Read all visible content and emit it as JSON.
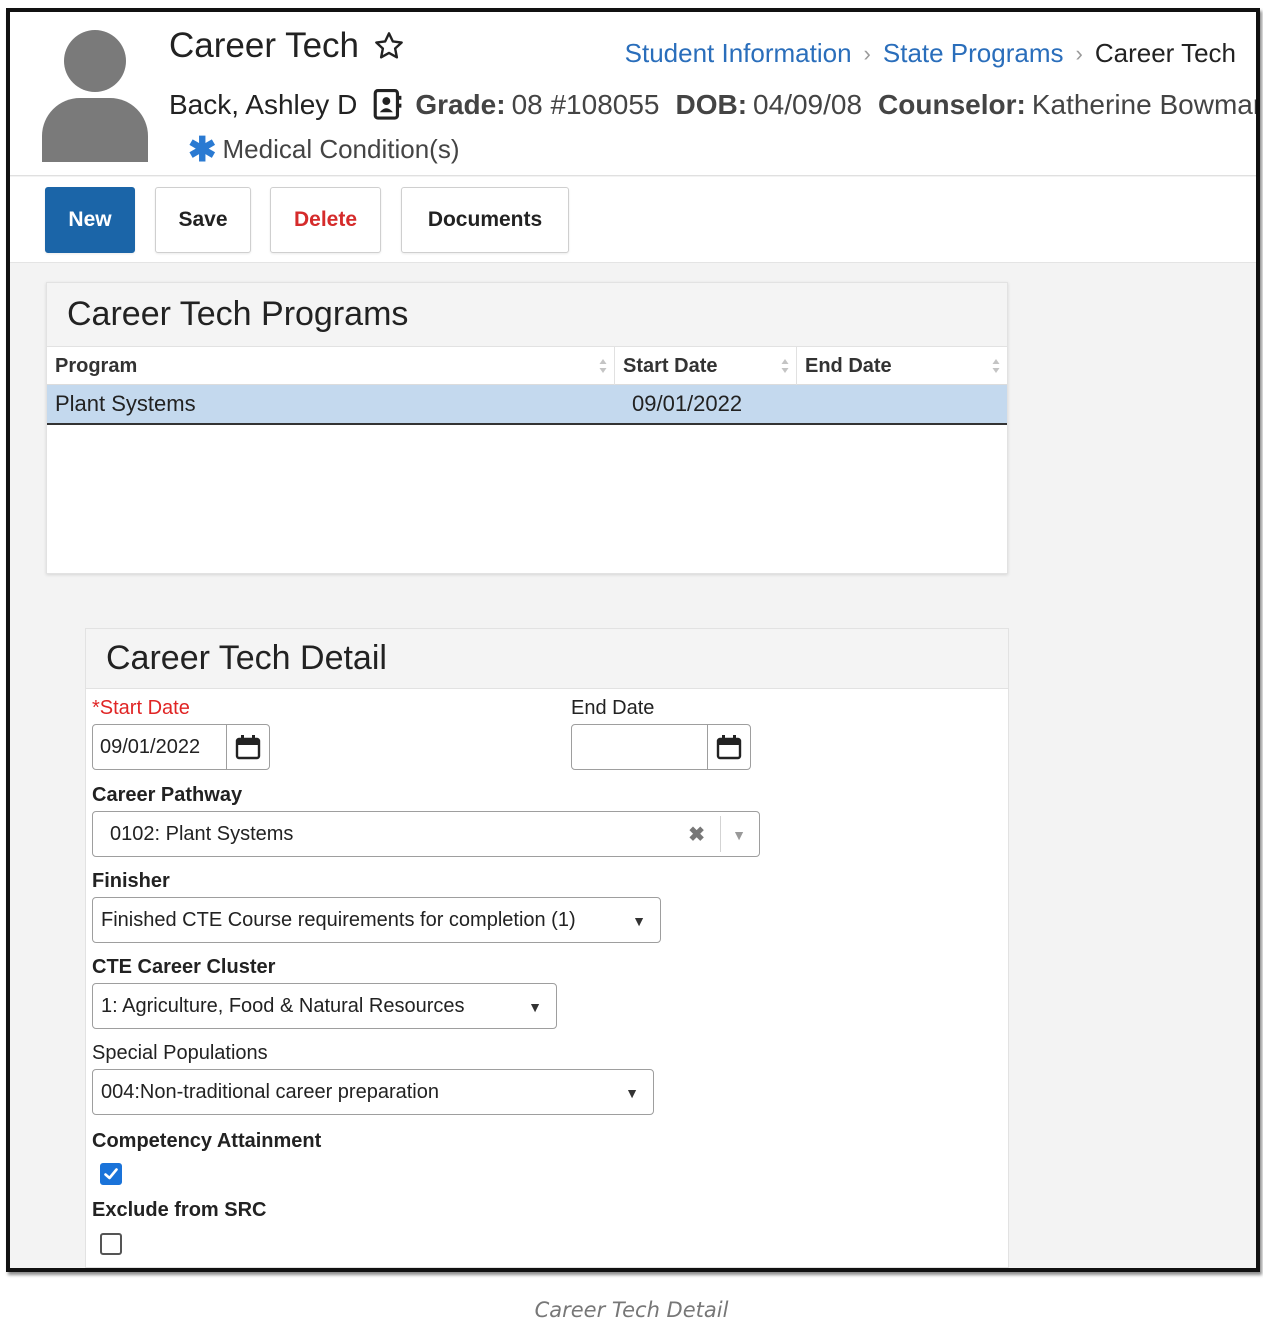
{
  "header": {
    "page_title": "Career Tech",
    "breadcrumb": [
      "Student Information",
      "State Programs",
      "Career Tech"
    ],
    "student": {
      "name": "Back, Ashley D",
      "grade_label": "Grade:",
      "grade_value": "08 #108055",
      "dob_label": "DOB:",
      "dob_value": "04/09/08",
      "counselor_label": "Counselor:",
      "counselor_value": "Katherine Bowman"
    },
    "medical": "Medical Condition(s)"
  },
  "toolbar": {
    "new_label": "New",
    "save_label": "Save",
    "delete_label": "Delete",
    "documents_label": "Documents"
  },
  "programs": {
    "title": "Career Tech Programs",
    "columns": [
      "Program",
      "Start Date",
      "End Date"
    ],
    "rows": [
      {
        "program": "Plant Systems",
        "start_date": "09/01/2022",
        "end_date": ""
      }
    ]
  },
  "detail": {
    "title": "Career Tech Detail",
    "start_date_label": "*Start Date",
    "start_date_value": "09/01/2022",
    "end_date_label": "End Date",
    "end_date_value": "",
    "career_pathway_label": "Career Pathway",
    "career_pathway_value": "0102: Plant Systems",
    "finisher_label": "Finisher",
    "finisher_value": "Finished CTE Course requirements for completion (1)",
    "cluster_label": "CTE Career Cluster",
    "cluster_value": "1: Agriculture, Food & Natural Resources",
    "special_pop_label": "Special Populations",
    "special_pop_value": "004:Non-traditional career preparation",
    "competency_label": "Competency Attainment",
    "competency_checked": true,
    "exclude_label": "Exclude from SRC",
    "exclude_checked": false
  },
  "caption": "Career Tech Detail",
  "colors": {
    "primary_button": "#1b65a8",
    "link": "#2a6ebb",
    "delete": "#d52b2b",
    "required": "#e02525",
    "selected_row": "#c4d9ee",
    "checkbox": "#1a73d9"
  }
}
